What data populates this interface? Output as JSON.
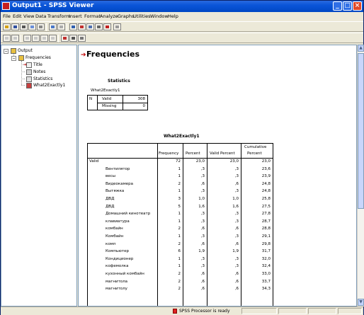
{
  "window": {
    "title": "Output1 - SPSS Viewer"
  },
  "menu": [
    "File",
    "Edit",
    "View",
    "Data",
    "Transform",
    "Insert",
    "Format",
    "Analyze",
    "Graphs",
    "Utilities",
    "Window",
    "Help"
  ],
  "tree": {
    "root": "Output",
    "section": "Frequencies",
    "children": [
      "Title",
      "Notes",
      "Statistics",
      "What2Exactly1"
    ]
  },
  "output": {
    "heading": "Frequencies",
    "statistics": {
      "title": "Statistics",
      "variable": "What2Exactly1",
      "n_label": "N",
      "valid_label": "Valid",
      "valid_value": "308",
      "missing_label": "Missing",
      "missing_value": "0"
    },
    "freq": {
      "title": "What2Exactly1",
      "col_frequency": "Frequency",
      "col_percent": "Percent",
      "col_valid_percent": "Valid Percent",
      "col_cum_line1": "Cumulative",
      "col_cum_line2": "Percent",
      "group_label": "Valid",
      "rows": [
        {
          "label": "",
          "f": "72",
          "p": "23,0",
          "vp": "23,0",
          "cp": "23,0"
        },
        {
          "label": "Вентилятор",
          "f": "1",
          "p": ",3",
          "vp": ",3",
          "cp": "23,6"
        },
        {
          "label": "весы",
          "f": "1",
          "p": ",3",
          "vp": ",3",
          "cp": "23,9"
        },
        {
          "label": "Видеокамера",
          "f": "2",
          "p": ",6",
          "vp": ",6",
          "cp": "24,8"
        },
        {
          "label": "Вытяжка",
          "f": "1",
          "p": ",3",
          "vp": ",3",
          "cp": "24,8"
        },
        {
          "label": "ДВД",
          "f": "3",
          "p": "1,0",
          "vp": "1,0",
          "cp": "25,8"
        },
        {
          "label": "ДВД",
          "f": "5",
          "p": "1,6",
          "vp": "1,6",
          "cp": "27,5"
        },
        {
          "label": "Домашний кинотеатр",
          "f": "1",
          "p": ",3",
          "vp": ",3",
          "cp": "27,8"
        },
        {
          "label": "клавиатура",
          "f": "1",
          "p": ",3",
          "vp": ",3",
          "cp": "28,7"
        },
        {
          "label": "комбайн",
          "f": "2",
          "p": ",6",
          "vp": ",6",
          "cp": "28,8"
        },
        {
          "label": "Комбайн",
          "f": "1",
          "p": ",3",
          "vp": ",3",
          "cp": "29,1"
        },
        {
          "label": "комп",
          "f": "2",
          "p": ",6",
          "vp": ",6",
          "cp": "29,8"
        },
        {
          "label": "Компьютер",
          "f": "6",
          "p": "1,9",
          "vp": "1,9",
          "cp": "31,7"
        },
        {
          "label": "Кондиционер",
          "f": "1",
          "p": ",3",
          "vp": ",3",
          "cp": "32,0"
        },
        {
          "label": "кофемолка",
          "f": "1",
          "p": ",3",
          "vp": ",3",
          "cp": "32,4"
        },
        {
          "label": "кухонный комбайн",
          "f": "2",
          "p": ",6",
          "vp": ",6",
          "cp": "33,0"
        },
        {
          "label": "магнитола",
          "f": "2",
          "p": ",6",
          "vp": ",6",
          "cp": "33,7"
        },
        {
          "label": "магнитолу",
          "f": "2",
          "p": ",6",
          "vp": ",6",
          "cp": "34,3"
        }
      ]
    }
  },
  "status": {
    "text": "SPSS Processor  is ready"
  },
  "colors": {
    "titlebar": "#0047c4",
    "arrow": "#c00000",
    "window_bg": "#ece9d8"
  }
}
